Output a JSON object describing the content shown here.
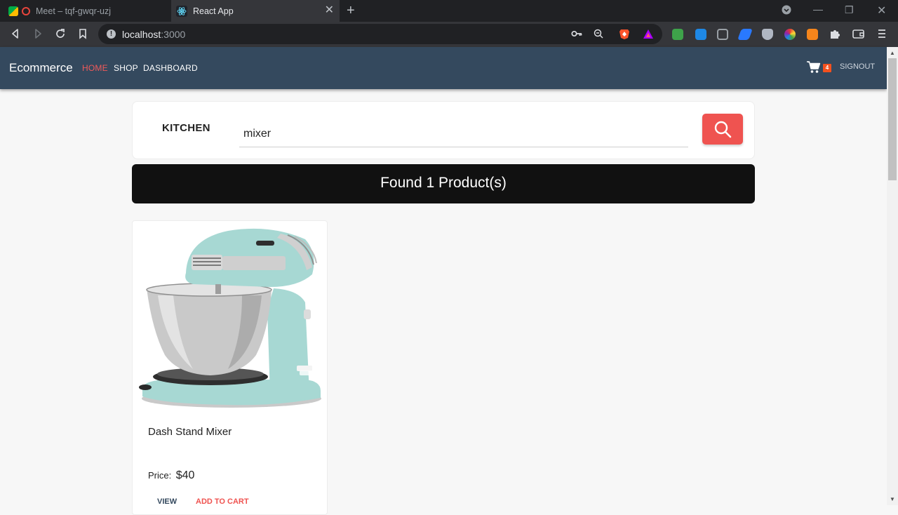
{
  "browser": {
    "tabs": [
      {
        "title": "Meet – tqf-gwqr-uzj"
      },
      {
        "title": "React App"
      }
    ],
    "url_host": "localhost",
    "url_port": ":3000"
  },
  "navbar": {
    "brand": "Ecommerce",
    "links": [
      {
        "label": "HOME"
      },
      {
        "label": "SHOP"
      },
      {
        "label": "DASHBOARD"
      }
    ],
    "cart_count": "4",
    "signout": "SIGNOUT"
  },
  "search": {
    "category": "KITCHEN",
    "query": "mixer"
  },
  "results": {
    "banner": "Found 1 Product(s)"
  },
  "products": [
    {
      "name": "Dash Stand Mixer",
      "price_label": "Price:",
      "price": "$40",
      "view_label": "VIEW",
      "add_label": "ADD TO CART"
    }
  ],
  "colors": {
    "navbar": "#34495e",
    "accent": "#ef5350",
    "banner": "#111111"
  }
}
